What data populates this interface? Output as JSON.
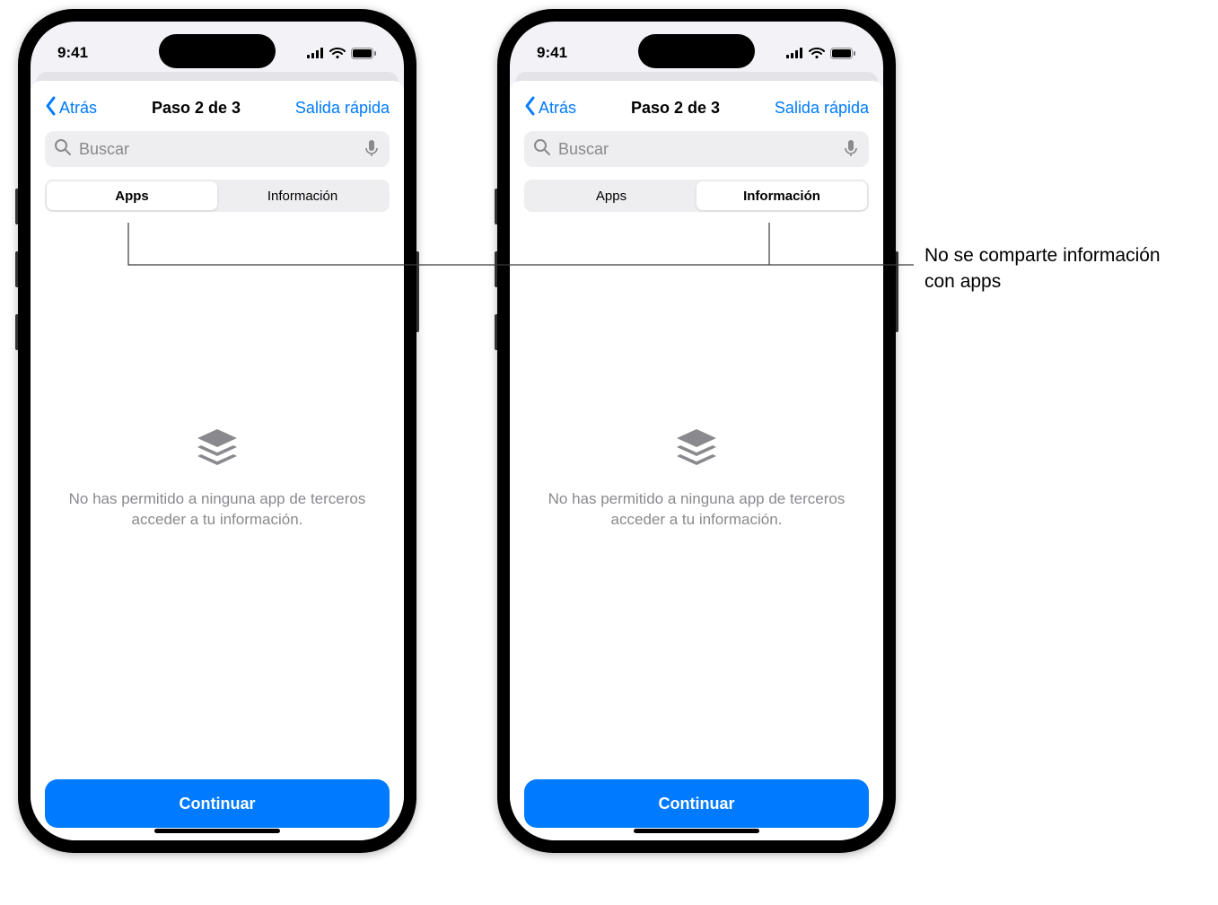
{
  "status": {
    "time": "9:41"
  },
  "nav": {
    "back": "Atrás",
    "title": "Paso 2 de 3",
    "action": "Salida rápida"
  },
  "search": {
    "placeholder": "Buscar"
  },
  "segments": {
    "apps": "Apps",
    "info": "Información"
  },
  "empty": {
    "text": "No has permitido a ninguna app de terceros acceder a tu información."
  },
  "continue": "Continuar",
  "phones": [
    {
      "active_segment": "apps"
    },
    {
      "active_segment": "info"
    }
  ],
  "callout": {
    "text": "No se comparte información con apps"
  }
}
